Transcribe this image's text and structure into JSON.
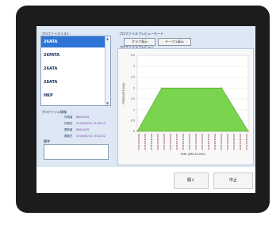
{
  "profile_list": {
    "label": "プロファイルリスト",
    "items": [
      "26ATA",
      "26FATA",
      "26ATA",
      "28ATA",
      "HKP"
    ],
    "selected_index": 0
  },
  "profile_info": {
    "label": "プロファイル情報",
    "rows": [
      {
        "key": "作成者",
        "value": "BWA.KCD"
      },
      {
        "key": "作成日",
        "value": "2016/05/15 15:36:43"
      },
      {
        "key": "更新者",
        "value": "BWA.KCD"
      },
      {
        "key": "更新日",
        "value": "2016/05/15 15:42:52"
      }
    ],
    "memo_label": "備考",
    "memo_value": ""
  },
  "preview_mode": {
    "label": "プロファイルプレビューモード",
    "graph_label": "グラフ表示",
    "table_label": "テーブル表示"
  },
  "preview": {
    "label": "プロファイルプレビュー"
  },
  "chart_data": {
    "type": "area",
    "ylabel": "PRESSURE (KN)",
    "xlabel": "TIME (MM:SS.SSS)",
    "yticks": [
      "3.5",
      "3",
      "2.5",
      "2",
      "1.5",
      "1",
      "0.5",
      "0"
    ],
    "ylim": [
      0,
      3.5
    ],
    "series": [
      {
        "values": [
          0,
          2.0,
          2.0,
          0
        ]
      }
    ],
    "x": [
      0,
      0.22,
      0.76,
      1
    ],
    "xtick_count": 18,
    "fill_color": "#7bd44e",
    "line_color": "#4f9b2d",
    "grid": true
  },
  "buttons": {
    "open_label": "開く",
    "cancel_label": "中止"
  },
  "colors": {
    "panel_bg": "#dde8f4",
    "selected_bg": "#2d74d6",
    "value_text": "#7b3aa6"
  }
}
